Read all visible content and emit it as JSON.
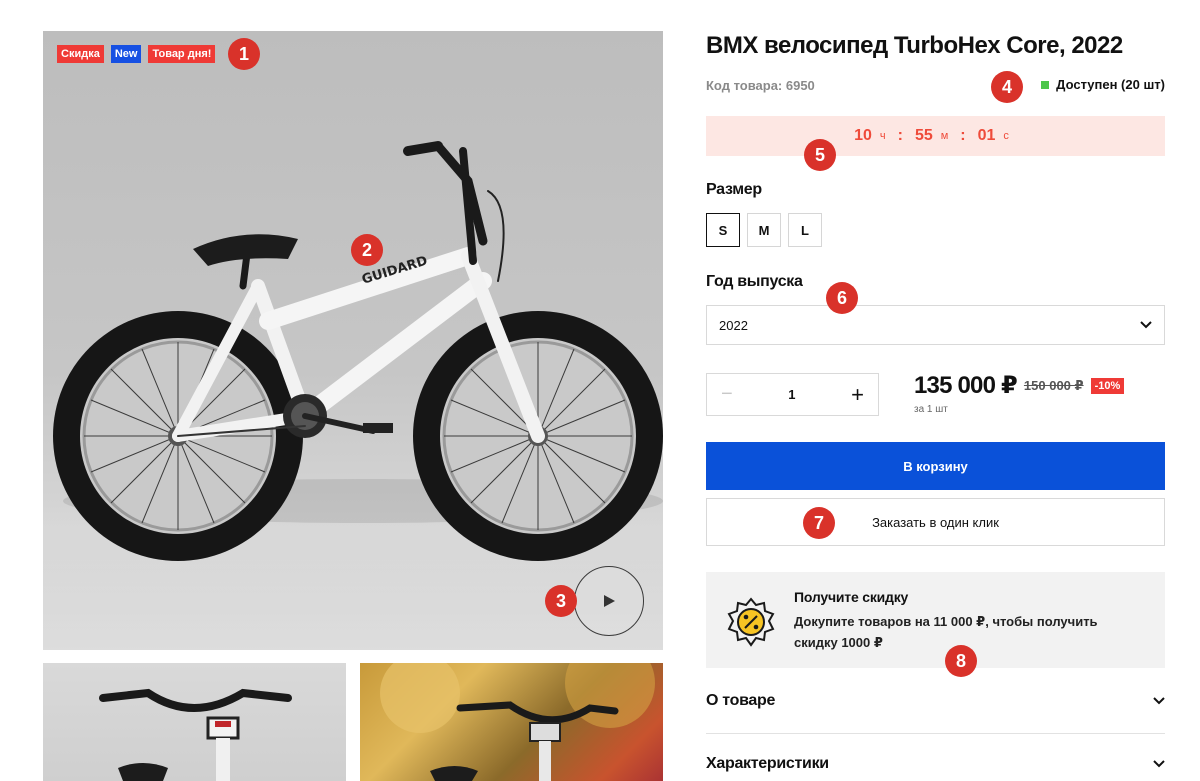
{
  "product": {
    "badges": [
      {
        "label": "Скидка",
        "color": "#ef3a36"
      },
      {
        "label": "New",
        "color": "#1650e3"
      },
      {
        "label": "Товар дня!",
        "color": "#ef3a36"
      }
    ],
    "title": "BMX велосипед TurboHex Core, 2022",
    "sku": "Код товара: 6950",
    "stock": "Доступен (20 шт)",
    "bike_frame_text": "GUIDARD"
  },
  "timer": {
    "hours": "10",
    "hours_unit": "ч",
    "minutes": "55",
    "minutes_unit": "м",
    "seconds": "01",
    "seconds_unit": "с",
    "separator": ":"
  },
  "size": {
    "label": "Размер",
    "options": [
      "S",
      "M",
      "L"
    ],
    "selected": "S"
  },
  "year": {
    "label": "Год выпуска",
    "value": "2022"
  },
  "quantity": {
    "minus": "−",
    "value": "1",
    "plus": "+"
  },
  "price": {
    "current": "135 000 ₽",
    "old": "150 000 ₽",
    "discount": "-10%",
    "per_unit": "за 1 шт"
  },
  "buttons": {
    "cart": "В корзину",
    "one_click": "Заказать в один клик"
  },
  "promo": {
    "title": "Получите скидку",
    "text": "Докупите товаров на 11 000 ₽, чтобы получить скидку 1000 ₽"
  },
  "accordion": [
    {
      "label": "О товаре"
    },
    {
      "label": "Характеристики"
    }
  ],
  "markers": [
    "1",
    "2",
    "3",
    "4",
    "5",
    "6",
    "7",
    "8"
  ],
  "colors": {
    "accent": "#0a51d9",
    "sale": "#ef3a36",
    "marker": "#d9322a",
    "in_stock": "#4cc64a"
  }
}
